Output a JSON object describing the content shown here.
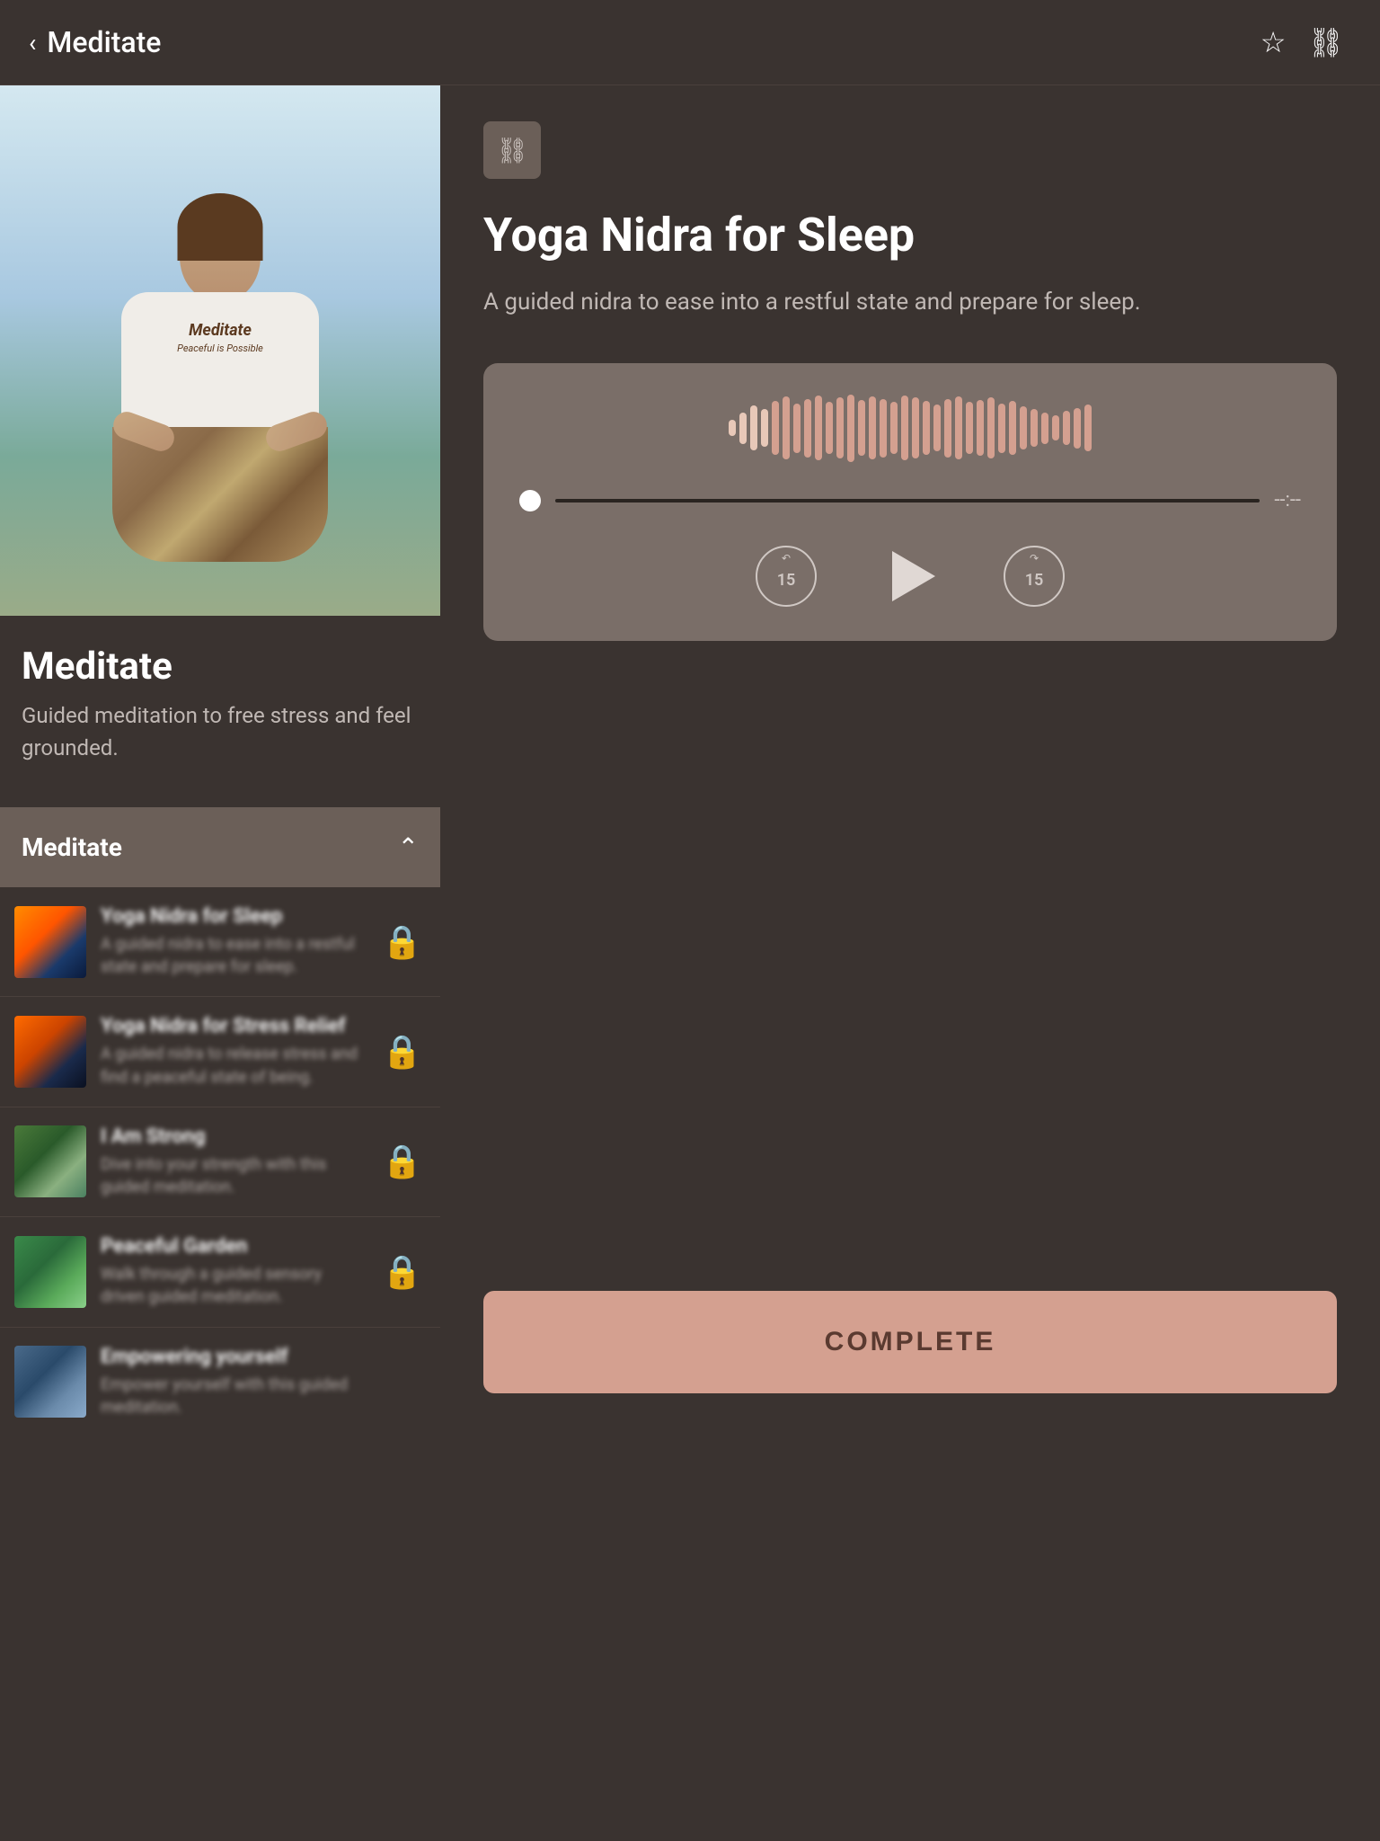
{
  "header": {
    "back_label": "Meditate",
    "bookmark_icon": "☆",
    "link_icon": "⛓"
  },
  "left": {
    "channel_title": "Meditate",
    "channel_description": "Guided meditation to free stress and feel grounded.",
    "hero_shirt_text": "Meditate",
    "hero_shirt_subtext": "Peaceful is Possible",
    "playlist": {
      "title": "Meditate",
      "items": [
        {
          "title": "Yoga Nidra for Sleep",
          "description": "A guided nidra to ease into a restful state and prepare for sleep.",
          "thumb_class": "thumb-1"
        },
        {
          "title": "Yoga Nidra for Stress Relief",
          "description": "A guided nidra to release stress and find a peaceful state of being.",
          "thumb_class": "thumb-2"
        },
        {
          "title": "I Am Strong",
          "description": "Dive into your strength with this guided meditation.",
          "thumb_class": "thumb-3"
        },
        {
          "title": "Peaceful Garden",
          "description": "Walk through a guided sensory driven guided meditation.",
          "thumb_class": "thumb-4"
        },
        {
          "title": "Empowering yourself",
          "description": "Empower yourself with this guided meditation.",
          "thumb_class": "thumb-5"
        }
      ]
    }
  },
  "right": {
    "link_icon": "⛓",
    "title": "Yoga Nidra for Sleep",
    "description": "A guided nidra to ease into a restful state and prepare for sleep.",
    "player": {
      "time_display": "--:--",
      "skip_back_label": "15",
      "skip_forward_label": "15"
    },
    "complete_button_label": "COMPLETE"
  },
  "waveform_bars": [
    18,
    35,
    50,
    42,
    60,
    70,
    55,
    65,
    72,
    58,
    68,
    75,
    62,
    70,
    65,
    58,
    72,
    68,
    60,
    52,
    65,
    70,
    58,
    62,
    68,
    55,
    60,
    48,
    42,
    35,
    28,
    38,
    45,
    52
  ]
}
